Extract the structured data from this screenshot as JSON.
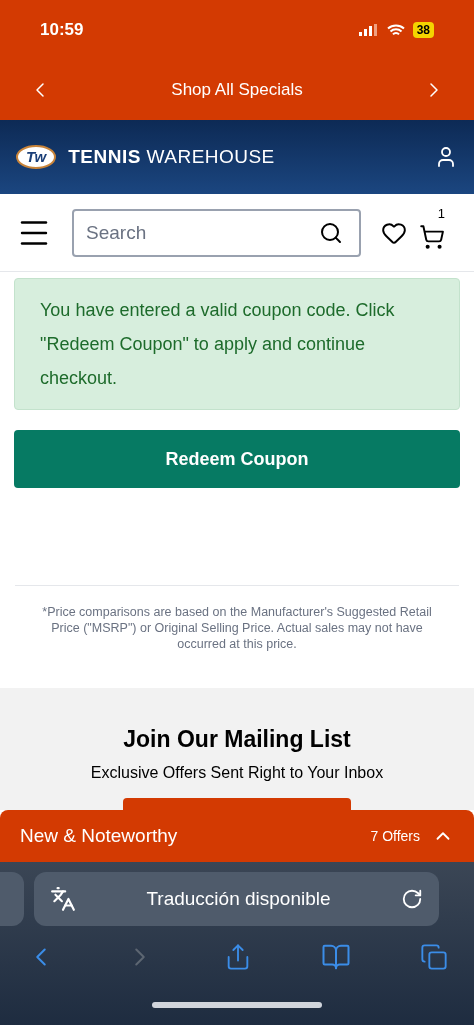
{
  "status_bar": {
    "time": "10:59",
    "battery": "38"
  },
  "promo_bar": {
    "text": "Shop All Specials"
  },
  "header": {
    "brand_bold": "TENNIS",
    "brand_light": "WAREHOUSE",
    "logo": "Tw"
  },
  "search": {
    "placeholder": "Search",
    "cart_count": "1"
  },
  "alert": {
    "text": "You have entered a valid coupon code. Click \"Redeem Coupon\" to apply and continue checkout."
  },
  "redeem_button": "Redeem Coupon",
  "disclaimer": "*Price comparisons are based on the Manufacturer's Suggested Retail Price (\"MSRP\") or Original Selling Price. Actual sales may not have occurred at this price.",
  "mailing": {
    "title": "Join Our Mailing List",
    "subtitle": "Exclusive Offers Sent Right to Your Inbox"
  },
  "offers_bar": {
    "title": "New & Noteworthy",
    "count": "7 Offers",
    "expanded": false
  },
  "browser": {
    "address": "Traducción disponible",
    "forward_disabled": true
  }
}
